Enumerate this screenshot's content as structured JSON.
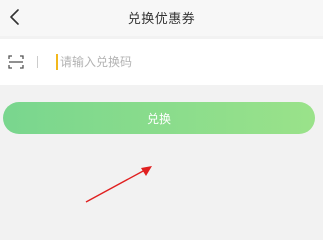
{
  "header": {
    "title": "兑换优惠券",
    "back_icon": "chevron-left-icon"
  },
  "redeem_form": {
    "scan_icon": "scan-icon",
    "code_placeholder": "请输入兑换码",
    "code_value": "",
    "submit_label": "兑换"
  },
  "colors": {
    "button_gradient_start": "#79d68e",
    "button_gradient_end": "#9ae28a",
    "caret": "#f2b81d",
    "annotation_arrow": "#e02020"
  }
}
